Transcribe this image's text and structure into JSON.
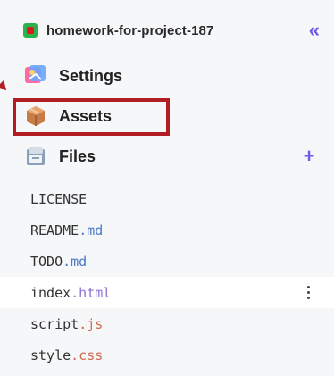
{
  "header": {
    "project_name": "homework-for-project-187",
    "collapse_symbol": "«",
    "project_icon": "project-badge-icon"
  },
  "nav": {
    "settings": {
      "label": "Settings",
      "icon": "settings-palette-icon"
    },
    "assets": {
      "label": "Assets",
      "icon": "assets-box-icon",
      "highlighted": true
    },
    "files": {
      "label": "Files",
      "icon": "files-folder-icon",
      "add_symbol": "+"
    }
  },
  "files": [
    {
      "name": "LICENSE",
      "ext": ""
    },
    {
      "name": "README",
      "ext": ".md"
    },
    {
      "name": "TODO",
      "ext": ".md"
    },
    {
      "name": "index",
      "ext": ".html",
      "active": true,
      "menu": true
    },
    {
      "name": "script",
      "ext": ".js"
    },
    {
      "name": "style",
      "ext": ".css"
    }
  ],
  "colors": {
    "accent": "#6b5de6",
    "highlight": "#b21c24",
    "project_icon": "#2bb24c"
  }
}
